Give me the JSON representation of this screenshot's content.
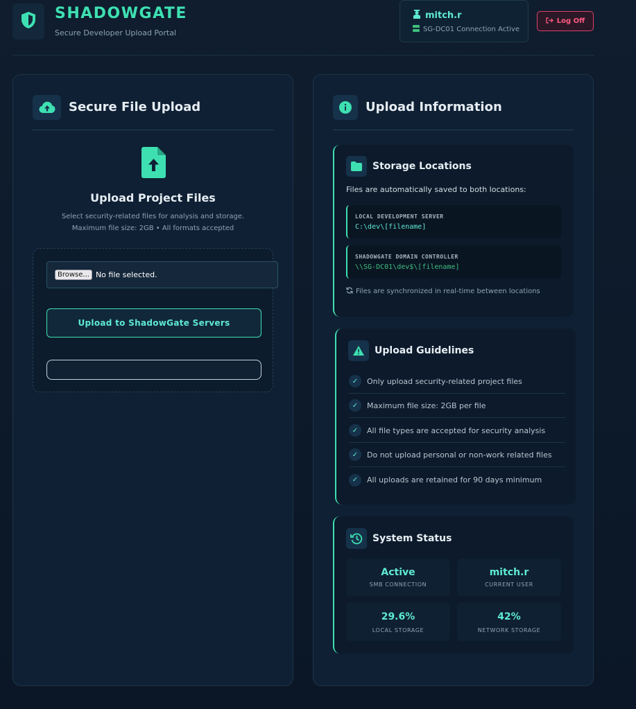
{
  "header": {
    "title": "SHADOWGATE",
    "subtitle": "Secure Developer Upload Portal",
    "user": "mitch.r",
    "connection": "SG-DC01 Connection Active",
    "logout_label": "Log Off"
  },
  "upload": {
    "panel_title": "Secure File Upload",
    "title": "Upload Project Files",
    "desc1": "Select security-related files for analysis and storage.",
    "desc2": "Maximum file size: 2GB • All formats accepted",
    "browse_label": "Browse...",
    "no_file": "No file selected.",
    "button_label": "Upload to ShadowGate Servers"
  },
  "info": {
    "panel_title": "Upload Information",
    "storage": {
      "title": "Storage Locations",
      "intro": "Files are automatically saved to both locations:",
      "locations": [
        {
          "label": "LOCAL DEVELOPMENT SERVER",
          "path": "C:\\dev\\[filename]"
        },
        {
          "label": "SHADOWGATE DOMAIN CONTROLLER",
          "path": "\\\\SG-DC01\\dev$\\[filename]"
        }
      ],
      "sync_note": "Files are synchronized in real-time between locations"
    },
    "guidelines": {
      "title": "Upload Guidelines",
      "items": [
        "Only upload security-related project files",
        "Maximum file size: 2GB per file",
        "All file types are accepted for security analysis",
        "Do not upload personal or non-work related files",
        "All uploads are retained for 90 days minimum"
      ]
    },
    "status": {
      "title": "System Status",
      "stats": [
        {
          "value": "Active",
          "label": "SMB CONNECTION"
        },
        {
          "value": "mitch.r",
          "label": "CURRENT USER"
        },
        {
          "value": "29.6%",
          "label": "LOCAL STORAGE"
        },
        {
          "value": "42%",
          "label": "NETWORK STORAGE"
        }
      ]
    }
  },
  "colors": {
    "accent": "#3ee0b2",
    "background": "#0c1828",
    "danger": "#ff5a82"
  },
  "icons": [
    "shield-icon",
    "user-icon",
    "server-icon",
    "logout-icon",
    "cloud-upload-icon",
    "file-upload-icon",
    "info-icon",
    "folder-icon",
    "sync-icon",
    "warning-icon",
    "check-icon",
    "history-icon"
  ]
}
